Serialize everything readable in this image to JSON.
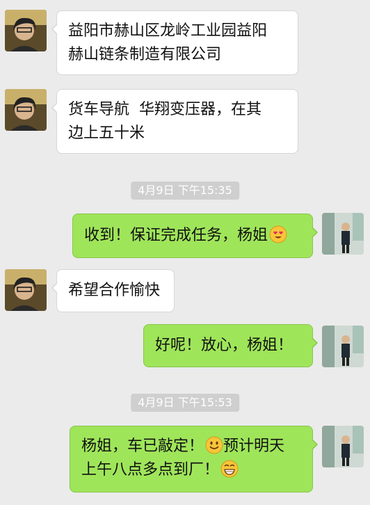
{
  "messages": [
    {
      "side": "in",
      "lines": [
        "益阳市赫山区龙岭工业园益阳",
        "赫山链条制造有限公司"
      ]
    },
    {
      "side": "in",
      "lines": [
        "货车导航  华翔变压器，在其",
        "边上五十米"
      ]
    },
    {
      "side": "out",
      "text": "收到！保证完成任务，杨姐",
      "emoji": "heart-eyes-emoji"
    },
    {
      "side": "in",
      "text": "希望合作愉快"
    },
    {
      "side": "out",
      "text": "好呢！放心，杨姐！"
    },
    {
      "side": "out",
      "line1": "杨姐，车已敲定！",
      "line1_tail": "预计明天",
      "line2": "上午八点多点到厂！",
      "emoji_1": "smile-emoji",
      "emoji_2": "grin-emoji"
    }
  ],
  "timestamps": [
    "4月9日 下午15:35",
    "4月9日 下午15:53"
  ],
  "colors": {
    "background": "#ebebeb",
    "outgoing_bubble": "#9fe55a",
    "incoming_bubble": "#ffffff",
    "timestamp_pill": "#cfcfcf"
  }
}
